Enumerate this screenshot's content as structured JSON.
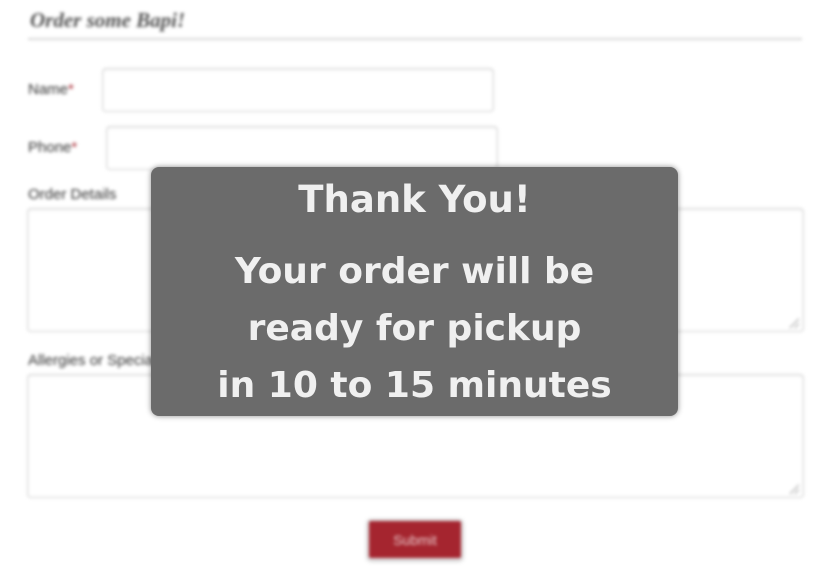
{
  "form": {
    "title": "Order some Bapi!",
    "required_marker": "*",
    "name_label": "Name",
    "phone_label": "Phone",
    "details_label": "Order Details",
    "allergies_label": "Allergies or Special Requests",
    "name_value": "",
    "phone_value": "",
    "details_value": "",
    "allergies_value": "",
    "submit_label": "Submit"
  },
  "overlay": {
    "title": "Thank You!",
    "message_lines": [
      "Your order will be",
      "ready for pickup",
      "in 10 to 15 minutes"
    ]
  },
  "colors": {
    "accent": "#a5252f",
    "overlay_bg": "#6b6b6b"
  }
}
